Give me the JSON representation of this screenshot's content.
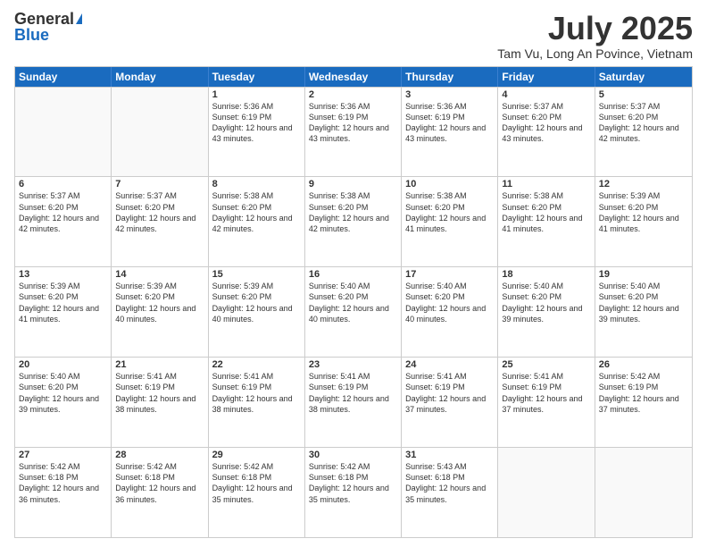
{
  "logo": {
    "general": "General",
    "blue": "Blue"
  },
  "title": {
    "month": "July 2025",
    "location": "Tam Vu, Long An Povince, Vietnam"
  },
  "header_days": [
    "Sunday",
    "Monday",
    "Tuesday",
    "Wednesday",
    "Thursday",
    "Friday",
    "Saturday"
  ],
  "weeks": [
    [
      {
        "day": "",
        "info": "",
        "empty": true
      },
      {
        "day": "",
        "info": "",
        "empty": true
      },
      {
        "day": "1",
        "info": "Sunrise: 5:36 AM\nSunset: 6:19 PM\nDaylight: 12 hours and 43 minutes."
      },
      {
        "day": "2",
        "info": "Sunrise: 5:36 AM\nSunset: 6:19 PM\nDaylight: 12 hours and 43 minutes."
      },
      {
        "day": "3",
        "info": "Sunrise: 5:36 AM\nSunset: 6:19 PM\nDaylight: 12 hours and 43 minutes."
      },
      {
        "day": "4",
        "info": "Sunrise: 5:37 AM\nSunset: 6:20 PM\nDaylight: 12 hours and 43 minutes."
      },
      {
        "day": "5",
        "info": "Sunrise: 5:37 AM\nSunset: 6:20 PM\nDaylight: 12 hours and 42 minutes."
      }
    ],
    [
      {
        "day": "6",
        "info": "Sunrise: 5:37 AM\nSunset: 6:20 PM\nDaylight: 12 hours and 42 minutes."
      },
      {
        "day": "7",
        "info": "Sunrise: 5:37 AM\nSunset: 6:20 PM\nDaylight: 12 hours and 42 minutes."
      },
      {
        "day": "8",
        "info": "Sunrise: 5:38 AM\nSunset: 6:20 PM\nDaylight: 12 hours and 42 minutes."
      },
      {
        "day": "9",
        "info": "Sunrise: 5:38 AM\nSunset: 6:20 PM\nDaylight: 12 hours and 42 minutes."
      },
      {
        "day": "10",
        "info": "Sunrise: 5:38 AM\nSunset: 6:20 PM\nDaylight: 12 hours and 41 minutes."
      },
      {
        "day": "11",
        "info": "Sunrise: 5:38 AM\nSunset: 6:20 PM\nDaylight: 12 hours and 41 minutes."
      },
      {
        "day": "12",
        "info": "Sunrise: 5:39 AM\nSunset: 6:20 PM\nDaylight: 12 hours and 41 minutes."
      }
    ],
    [
      {
        "day": "13",
        "info": "Sunrise: 5:39 AM\nSunset: 6:20 PM\nDaylight: 12 hours and 41 minutes."
      },
      {
        "day": "14",
        "info": "Sunrise: 5:39 AM\nSunset: 6:20 PM\nDaylight: 12 hours and 40 minutes."
      },
      {
        "day": "15",
        "info": "Sunrise: 5:39 AM\nSunset: 6:20 PM\nDaylight: 12 hours and 40 minutes."
      },
      {
        "day": "16",
        "info": "Sunrise: 5:40 AM\nSunset: 6:20 PM\nDaylight: 12 hours and 40 minutes."
      },
      {
        "day": "17",
        "info": "Sunrise: 5:40 AM\nSunset: 6:20 PM\nDaylight: 12 hours and 40 minutes."
      },
      {
        "day": "18",
        "info": "Sunrise: 5:40 AM\nSunset: 6:20 PM\nDaylight: 12 hours and 39 minutes."
      },
      {
        "day": "19",
        "info": "Sunrise: 5:40 AM\nSunset: 6:20 PM\nDaylight: 12 hours and 39 minutes."
      }
    ],
    [
      {
        "day": "20",
        "info": "Sunrise: 5:40 AM\nSunset: 6:20 PM\nDaylight: 12 hours and 39 minutes."
      },
      {
        "day": "21",
        "info": "Sunrise: 5:41 AM\nSunset: 6:19 PM\nDaylight: 12 hours and 38 minutes."
      },
      {
        "day": "22",
        "info": "Sunrise: 5:41 AM\nSunset: 6:19 PM\nDaylight: 12 hours and 38 minutes."
      },
      {
        "day": "23",
        "info": "Sunrise: 5:41 AM\nSunset: 6:19 PM\nDaylight: 12 hours and 38 minutes."
      },
      {
        "day": "24",
        "info": "Sunrise: 5:41 AM\nSunset: 6:19 PM\nDaylight: 12 hours and 37 minutes."
      },
      {
        "day": "25",
        "info": "Sunrise: 5:41 AM\nSunset: 6:19 PM\nDaylight: 12 hours and 37 minutes."
      },
      {
        "day": "26",
        "info": "Sunrise: 5:42 AM\nSunset: 6:19 PM\nDaylight: 12 hours and 37 minutes."
      }
    ],
    [
      {
        "day": "27",
        "info": "Sunrise: 5:42 AM\nSunset: 6:18 PM\nDaylight: 12 hours and 36 minutes."
      },
      {
        "day": "28",
        "info": "Sunrise: 5:42 AM\nSunset: 6:18 PM\nDaylight: 12 hours and 36 minutes."
      },
      {
        "day": "29",
        "info": "Sunrise: 5:42 AM\nSunset: 6:18 PM\nDaylight: 12 hours and 35 minutes."
      },
      {
        "day": "30",
        "info": "Sunrise: 5:42 AM\nSunset: 6:18 PM\nDaylight: 12 hours and 35 minutes."
      },
      {
        "day": "31",
        "info": "Sunrise: 5:43 AM\nSunset: 6:18 PM\nDaylight: 12 hours and 35 minutes."
      },
      {
        "day": "",
        "info": "",
        "empty": true
      },
      {
        "day": "",
        "info": "",
        "empty": true
      }
    ]
  ]
}
